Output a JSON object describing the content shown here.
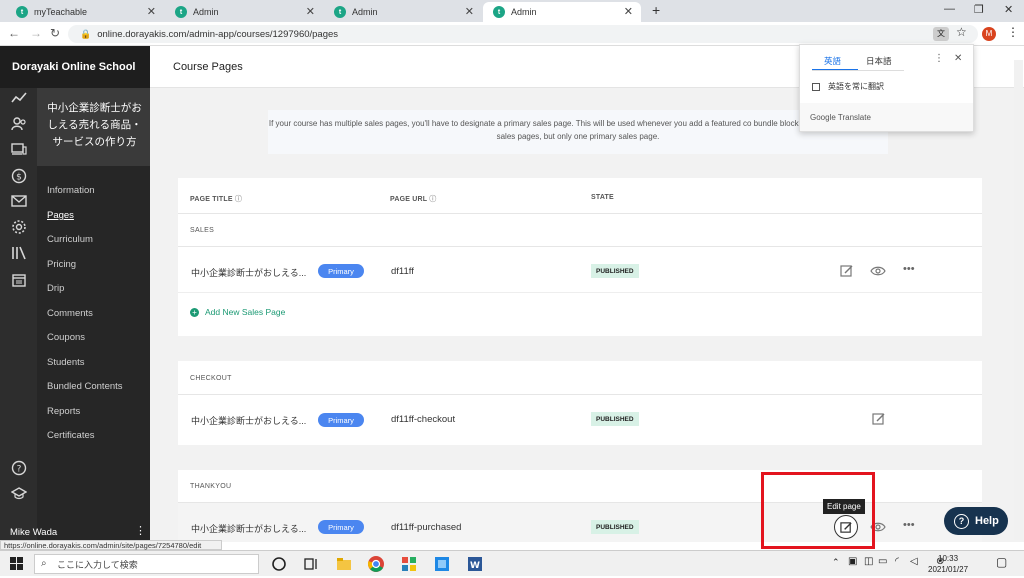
{
  "browser": {
    "tabs": [
      {
        "title": "myTeachable"
      },
      {
        "title": "Admin"
      },
      {
        "title": "Admin"
      },
      {
        "title": "Admin"
      }
    ],
    "url": "online.dorayakis.com/admin-app/courses/1297960/pages",
    "status_url": "https://online.dorayakis.com/admin/site/pages/7254780/edit",
    "profile_initial": "M"
  },
  "translate_popup": {
    "lang_from": "英語",
    "lang_to": "日本語",
    "always_translate": "英語を常に翻訳",
    "brand": "Google Translate"
  },
  "sidebar": {
    "school_name": "Dorayaki Online School",
    "course_title": "中小企業診断士がおしえる売れる商品・サービスの作り方",
    "items": [
      {
        "label": "Information"
      },
      {
        "label": "Pages"
      },
      {
        "label": "Curriculum"
      },
      {
        "label": "Pricing"
      },
      {
        "label": "Drip"
      },
      {
        "label": "Comments"
      },
      {
        "label": "Coupons"
      },
      {
        "label": "Students"
      },
      {
        "label": "Bundled Contents"
      },
      {
        "label": "Reports"
      },
      {
        "label": "Certificates"
      }
    ],
    "active_item": "Pages",
    "user_name": "Mike Wada"
  },
  "page": {
    "title": "Course Pages",
    "info_text": "If your course has multiple sales pages, you'll have to designate a primary sales page. This will be used whenever you add a featured co bundle block. You can create up to 10 sales pages, but only one primary sales page.",
    "columns": {
      "title": "PAGE TITLE",
      "url": "PAGE URL",
      "state": "STATE"
    },
    "add_sales_page": "Add New Sales Page",
    "sections": [
      {
        "name": "SALES",
        "rows": [
          {
            "title": "中小企業診断士がおしえる...",
            "badge": "Primary",
            "url": "df11ff",
            "state": "PUBLISHED"
          }
        ]
      },
      {
        "name": "CHECKOUT",
        "rows": [
          {
            "title": "中小企業診断士がおしえる...",
            "badge": "Primary",
            "url": "df11ff-checkout",
            "state": "PUBLISHED"
          }
        ]
      },
      {
        "name": "THANKYOU",
        "rows": [
          {
            "title": "中小企業診断士がおしえる...",
            "badge": "Primary",
            "url": "df11ff-purchased",
            "state": "PUBLISHED"
          }
        ]
      }
    ],
    "tooltip": "Edit page",
    "help_label": "Help"
  },
  "taskbar": {
    "search_placeholder": "ここに入力して検索",
    "time": "10:33",
    "date": "2021/01/27"
  },
  "colors": {
    "accent_green": "#1c9a74",
    "primary_badge": "#4b86f0",
    "highlight_red": "#e3141e",
    "sidebar_bg": "#262626"
  }
}
